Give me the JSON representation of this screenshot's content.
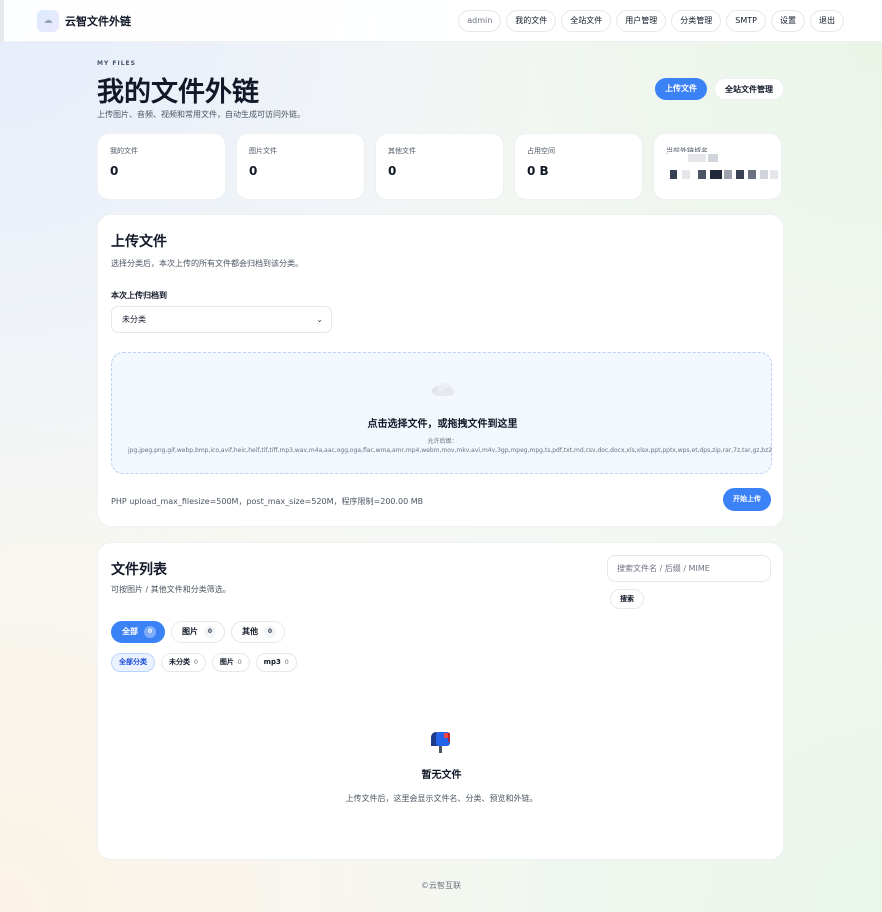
{
  "brand": {
    "name": "云智文件外链"
  },
  "nav": {
    "items": [
      {
        "label": "admin"
      },
      {
        "label": "我的文件"
      },
      {
        "label": "全站文件"
      },
      {
        "label": "用户管理"
      },
      {
        "label": "分类管理"
      },
      {
        "label": "SMTP"
      },
      {
        "label": "设置"
      },
      {
        "label": "退出"
      }
    ]
  },
  "header": {
    "eyebrow": "MY FILES",
    "title": "我的文件外链",
    "subtitle": "上传图片、音频、视频和常用文件，自动生成可访问外链。",
    "upload_label": "上传文件",
    "all_files_label": "全站文件管理"
  },
  "stats": [
    {
      "label": "我的文件",
      "value": "0"
    },
    {
      "label": "图片文件",
      "value": "0"
    },
    {
      "label": "其他文件",
      "value": "0"
    },
    {
      "label": "占用空间",
      "value": "0 B"
    }
  ],
  "domain_card": {
    "label": "当前外链域名"
  },
  "upload": {
    "title": "上传文件",
    "subtitle": "选择分类后，本次上传的所有文件都会归档到该分类。",
    "category_label": "本次上传归档到",
    "category_value": "未分类",
    "drop_title": "点击选择文件，或拖拽文件到这里",
    "allowed_ext": "允许后缀：jpg,jpeg,png,gif,webp,bmp,ico,avif,heic,heif,tif,tiff,mp3,wav,m4a,aac,ogg,oga,flac,wma,amr,mp4,webm,mov,mkv,avi,m4v,3gp,mpeg,mpg,ts,pdf,txt,md,csv,doc,docx,xls,xlsx,ppt,pptx,wps,et,dps,zip,rar,7z,tar,gz,bz2",
    "limits": "PHP upload_max_filesize=500M，post_max_size=520M，程序限制=200.00 MB",
    "start_label": "开始上传"
  },
  "list": {
    "title": "文件列表",
    "subtitle": "可按图片 / 其他文件和分类筛选。",
    "search_placeholder": "搜索文件名 / 后缀 / MIME",
    "search_label": "搜索",
    "tabs": [
      {
        "label": "全部",
        "count": "0"
      },
      {
        "label": "图片",
        "count": "0"
      },
      {
        "label": "其他",
        "count": "0"
      }
    ],
    "chips": [
      {
        "label": "全部分类",
        "count": ""
      },
      {
        "label": "未分类",
        "count": "0"
      },
      {
        "label": "图片",
        "count": "0"
      },
      {
        "label": "mp3",
        "count": "0"
      }
    ],
    "empty_title": "暂无文件",
    "empty_subtitle": "上传文件后，这里会显示文件名、分类、预览和外链。"
  },
  "footer": {
    "text": "©云智互联"
  },
  "colors": {
    "accent": "#3b82f6",
    "accent_light": "#eaf2ff"
  }
}
